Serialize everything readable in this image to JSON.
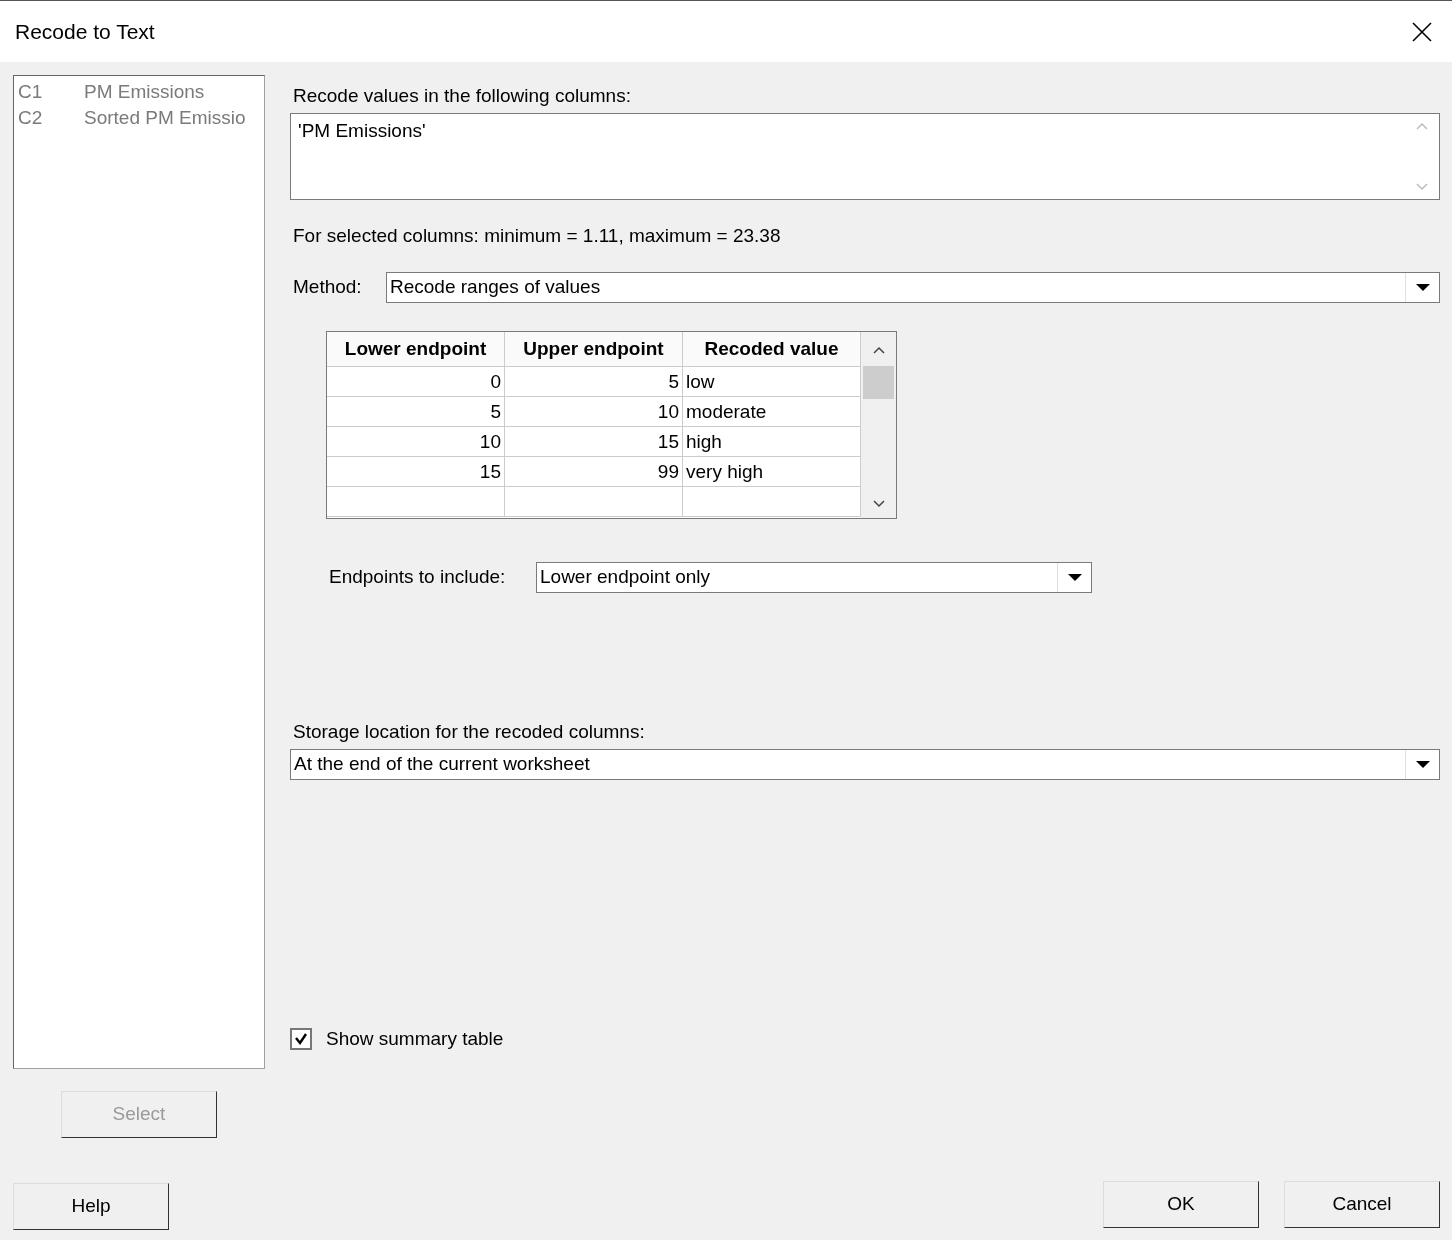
{
  "window": {
    "title": "Recode to Text"
  },
  "column_list": {
    "disabled": true,
    "items": [
      {
        "id": "C1",
        "name": "PM Emissions"
      },
      {
        "id": "C2",
        "name": "Sorted PM Emissio"
      }
    ]
  },
  "select_button": {
    "label": "Select",
    "disabled": true
  },
  "columns_field": {
    "label": "Recode values in the following columns:",
    "value": "'PM Emissions'"
  },
  "range_info": "For selected columns: minimum = 1.11, maximum = 23.38",
  "method": {
    "label": "Method:",
    "value": "Recode ranges of values"
  },
  "table": {
    "columns": [
      "Lower endpoint",
      "Upper endpoint",
      "Recoded value"
    ],
    "rows": [
      [
        "0",
        "5",
        "low"
      ],
      [
        "5",
        "10",
        "moderate"
      ],
      [
        "10",
        "15",
        "high"
      ],
      [
        "15",
        "99",
        "very high"
      ]
    ]
  },
  "endpoints": {
    "label": "Endpoints to include:",
    "value": "Lower endpoint only"
  },
  "storage": {
    "label": "Storage location for the recoded columns:",
    "value": "At the end of the current worksheet"
  },
  "summary_checkbox": {
    "label": "Show summary table",
    "checked": true
  },
  "buttons": [
    {
      "label": "Help"
    },
    {
      "label": "OK"
    },
    {
      "label": "Cancel"
    }
  ]
}
